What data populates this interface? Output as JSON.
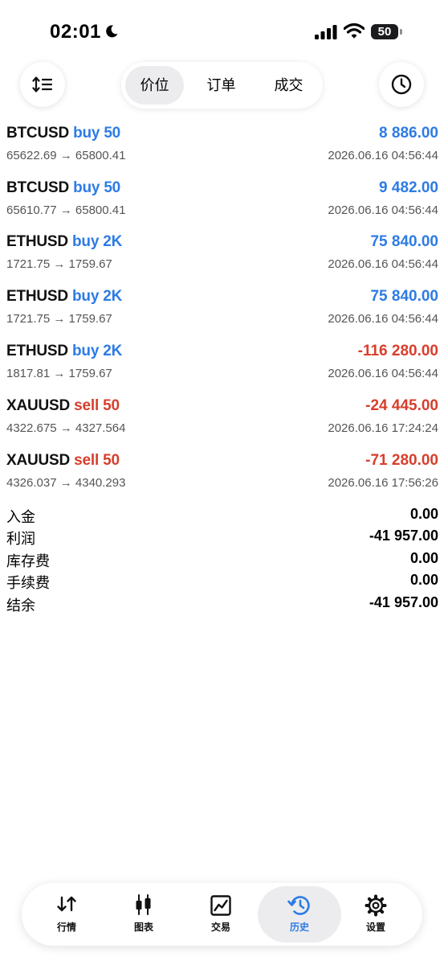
{
  "status_bar": {
    "time": "02:01",
    "battery": "50"
  },
  "header": {
    "sort_icon": "sort-arrows-icon",
    "history_icon": "clock-icon",
    "tabs": [
      "价位",
      "订单",
      "成交"
    ],
    "active_tab": "价位"
  },
  "colors": {
    "profit": "#2d7be5",
    "loss": "#d83e2c",
    "accent": "#2d7be5"
  },
  "trades": [
    {
      "symbol": "BTCUSD",
      "side": "buy 50",
      "direction": "buy",
      "prices": "65622.69 → 65800.41",
      "profit": "8 886.00",
      "time": "2026.06.16 04:56:44"
    },
    {
      "symbol": "BTCUSD",
      "side": "buy 50",
      "direction": "buy",
      "prices": "65610.77 → 65800.41",
      "profit": "9 482.00",
      "time": "2026.06.16 04:56:44"
    },
    {
      "symbol": "ETHUSD",
      "side": "buy 2K",
      "direction": "buy",
      "prices": "1721.75 → 1759.67",
      "profit": "75 840.00",
      "time": "2026.06.16 04:56:44"
    },
    {
      "symbol": "ETHUSD",
      "side": "buy 2K",
      "direction": "buy",
      "prices": "1721.75 → 1759.67",
      "profit": "75 840.00",
      "time": "2026.06.16 04:56:44"
    },
    {
      "symbol": "ETHUSD",
      "side": "buy 2K",
      "direction": "buy",
      "prices": "1817.81 → 1759.67",
      "profit": "-116 280.00",
      "time": "2026.06.16 04:56:44"
    },
    {
      "symbol": "XAUUSD",
      "side": "sell 50",
      "direction": "sell",
      "prices": "4322.675 → 4327.564",
      "profit": "-24 445.00",
      "time": "2026.06.16 17:24:24"
    },
    {
      "symbol": "XAUUSD",
      "side": "sell 50",
      "direction": "sell",
      "prices": "4326.037 → 4340.293",
      "profit": "-71 280.00",
      "time": "2026.06.16 17:56:26"
    }
  ],
  "summary": [
    {
      "label": "入金",
      "value": "0.00"
    },
    {
      "label": "利润",
      "value": "-41 957.00"
    },
    {
      "label": "库存费",
      "value": "0.00"
    },
    {
      "label": "手续费",
      "value": "0.00"
    },
    {
      "label": "结余",
      "value": "-41 957.00"
    }
  ],
  "tabbar": [
    {
      "label": "行情",
      "icon": "quotes-icon"
    },
    {
      "label": "图表",
      "icon": "chart-icon"
    },
    {
      "label": "交易",
      "icon": "trade-icon"
    },
    {
      "label": "历史",
      "icon": "history-icon",
      "active": true
    },
    {
      "label": "设置",
      "icon": "settings-icon"
    }
  ]
}
